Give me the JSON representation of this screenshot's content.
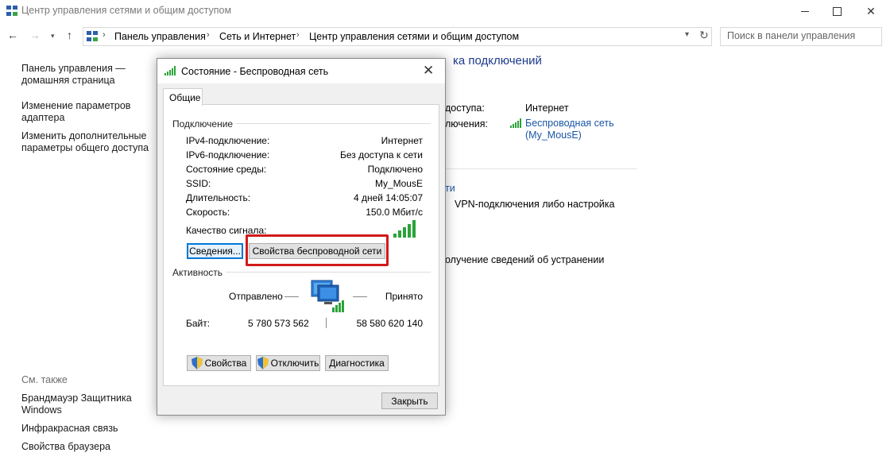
{
  "window": {
    "title": "Центр управления сетями и общим доступом"
  },
  "address": {
    "crumbs": [
      "Панель управления",
      "Сеть и Интернет",
      "Центр управления сетями и общим доступом"
    ],
    "search_placeholder": "Поиск в панели управления"
  },
  "sidebar": {
    "links": [
      "Панель управления —\nдомашняя страница",
      "Изменение параметров\nадаптера",
      "Изменить дополнительные\nпараметры общего доступа"
    ],
    "see_also_label": "См. также",
    "see_also": [
      "Брандмауэр Защитника\nWindows",
      "Инфракрасная связь",
      "Свойства браузера"
    ]
  },
  "main": {
    "heading_fragment": "ка подключений",
    "access_type_fragment": "доступа:",
    "access_type_value": "Интернет",
    "connections_fragment": "лючения:",
    "connection_link": "Беспроводная сеть\n(My_MousE)",
    "setup_link_fragment": "ти",
    "vpn_fragment": "VPN-подключения либо настройка",
    "troubleshoot_fragment": "олучение сведений об устранении"
  },
  "dialog": {
    "title": "Состояние - Беспроводная сеть",
    "tab": "Общие",
    "connection_group": "Подключение",
    "rows": [
      {
        "label": "IPv4-подключение:",
        "value": "Интернет"
      },
      {
        "label": "IPv6-подключение:",
        "value": "Без доступа к сети"
      },
      {
        "label": "Состояние среды:",
        "value": "Подключено"
      },
      {
        "label": "SSID:",
        "value": "My_MousE"
      },
      {
        "label": "Длительность:",
        "value": "4 дней 14:05:07"
      },
      {
        "label": "Скорость:",
        "value": "150.0 Мбит/с"
      }
    ],
    "signal_label": "Качество сигнала:",
    "details_button": "Сведения...",
    "wireless_props_button": "Свойства беспроводной сети",
    "activity_group": "Активность",
    "sent_label": "Отправлено",
    "received_label": "Принято",
    "bytes_label": "Байт:",
    "bytes_sent": "5 780 573 562",
    "bytes_received": "58 580 620 140",
    "properties_button": "Свойства",
    "disable_button": "Отключить",
    "diagnose_button": "Диагностика",
    "close_button": "Закрыть"
  },
  "colors": {
    "link": "#1a56a8",
    "highlight": "#d11a1a",
    "signal": "#2aa33a"
  }
}
